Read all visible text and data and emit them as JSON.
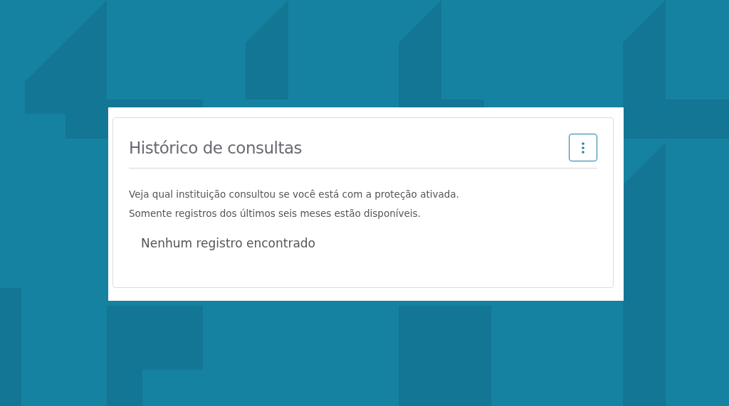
{
  "card": {
    "title": "Histórico de consultas",
    "description": [
      "Veja qual instituição consultou se você está com a proteção ativada.",
      "Somente registros dos últimos seis meses estão disponíveis."
    ],
    "empty_message": "Nenhum registro encontrado"
  }
}
